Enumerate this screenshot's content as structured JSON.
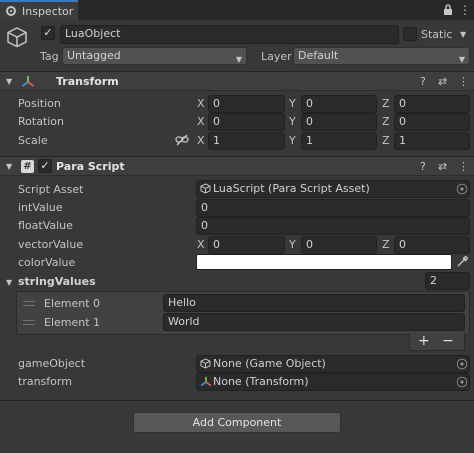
{
  "tab": {
    "title": "Inspector"
  },
  "object": {
    "name": "LuaObject",
    "static_label": "Static",
    "tag_label": "Tag",
    "tag_value": "Untagged",
    "layer_label": "Layer",
    "layer_value": "Default"
  },
  "transform": {
    "title": "Transform",
    "rows": [
      {
        "label": "Position",
        "x": "0",
        "y": "0",
        "z": "0"
      },
      {
        "label": "Rotation",
        "x": "0",
        "y": "0",
        "z": "0"
      },
      {
        "label": "Scale",
        "x": "1",
        "y": "1",
        "z": "1"
      }
    ],
    "axis_labels": {
      "x": "X",
      "y": "Y",
      "z": "Z"
    }
  },
  "para": {
    "title": "Para Script",
    "script_asset_label": "Script Asset",
    "script_asset_value": "LuaScript (Para Script Asset)",
    "int_label": "intValue",
    "int_value": "0",
    "float_label": "floatValue",
    "float_value": "0",
    "vector_label": "vectorValue",
    "vector": {
      "x": "0",
      "y": "0",
      "z": "0"
    },
    "color_label": "colorValue",
    "color_value": "#ffffff",
    "strings_label": "stringValues",
    "strings_count": "2",
    "elements": [
      {
        "label": "Element 0",
        "value": "Hello"
      },
      {
        "label": "Element 1",
        "value": "World"
      }
    ],
    "add_glyph": "+",
    "remove_glyph": "−",
    "game_object_label": "gameObject",
    "game_object_value": "None (Game Object)",
    "transform_label": "transform",
    "transform_value": "None (Transform)"
  },
  "add_component_label": "Add Component",
  "icons": {
    "help": "?",
    "settings": "⇄",
    "more": "⋮",
    "check": "✓"
  }
}
